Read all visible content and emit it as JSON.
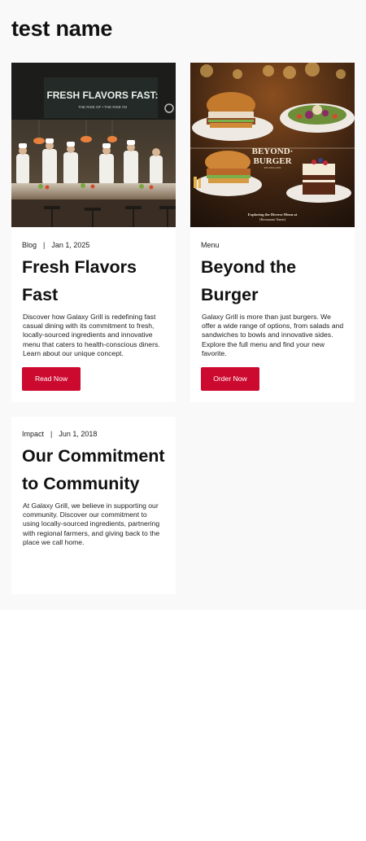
{
  "page": {
    "title": "test name"
  },
  "cards": [
    {
      "category": "Blog",
      "date": "Jan 1, 2025",
      "title": "Fresh Flavors Fast",
      "text": "Discover how Galaxy Grill is redefining fast casual dining with its commitment to fresh, locally-sourced ingredients and innovative menu that caters to health-conscious diners. Learn about our unique concept.",
      "button": "Read Now",
      "image": {
        "sign_title": "FRESH FLAVORS FAST:",
        "sign_sub": "THE RISE OF • THE RISE I'M"
      }
    },
    {
      "category": "Menu",
      "title": "Beyond the Burger",
      "text": "Galaxy Grill is more than just burgers. We offer a wide range of options, from salads and sandwiches to bowls and innovative sides. Explore the full menu and find your new favorite.",
      "button": "Order Now",
      "image": {
        "heading_line1": "BEYOND·",
        "heading_line2": "BURGER",
        "heading_small": "ETH MALLASS",
        "caption_line1": "Exploring the Diverse Menu at",
        "caption_line2": "[Restaurant Name]"
      }
    },
    {
      "category": "Impact",
      "date": "Jun 1, 2018",
      "title": "Our Commitment to Community",
      "text": "At Galaxy Grill, we believe in supporting our community. Discover our commitment to using locally-sourced ingredients, partnering with regional farmers, and giving back to the place we call home."
    }
  ],
  "colors": {
    "accent": "#cc0a2f",
    "background": "#f9f9f9",
    "card": "#ffffff"
  }
}
